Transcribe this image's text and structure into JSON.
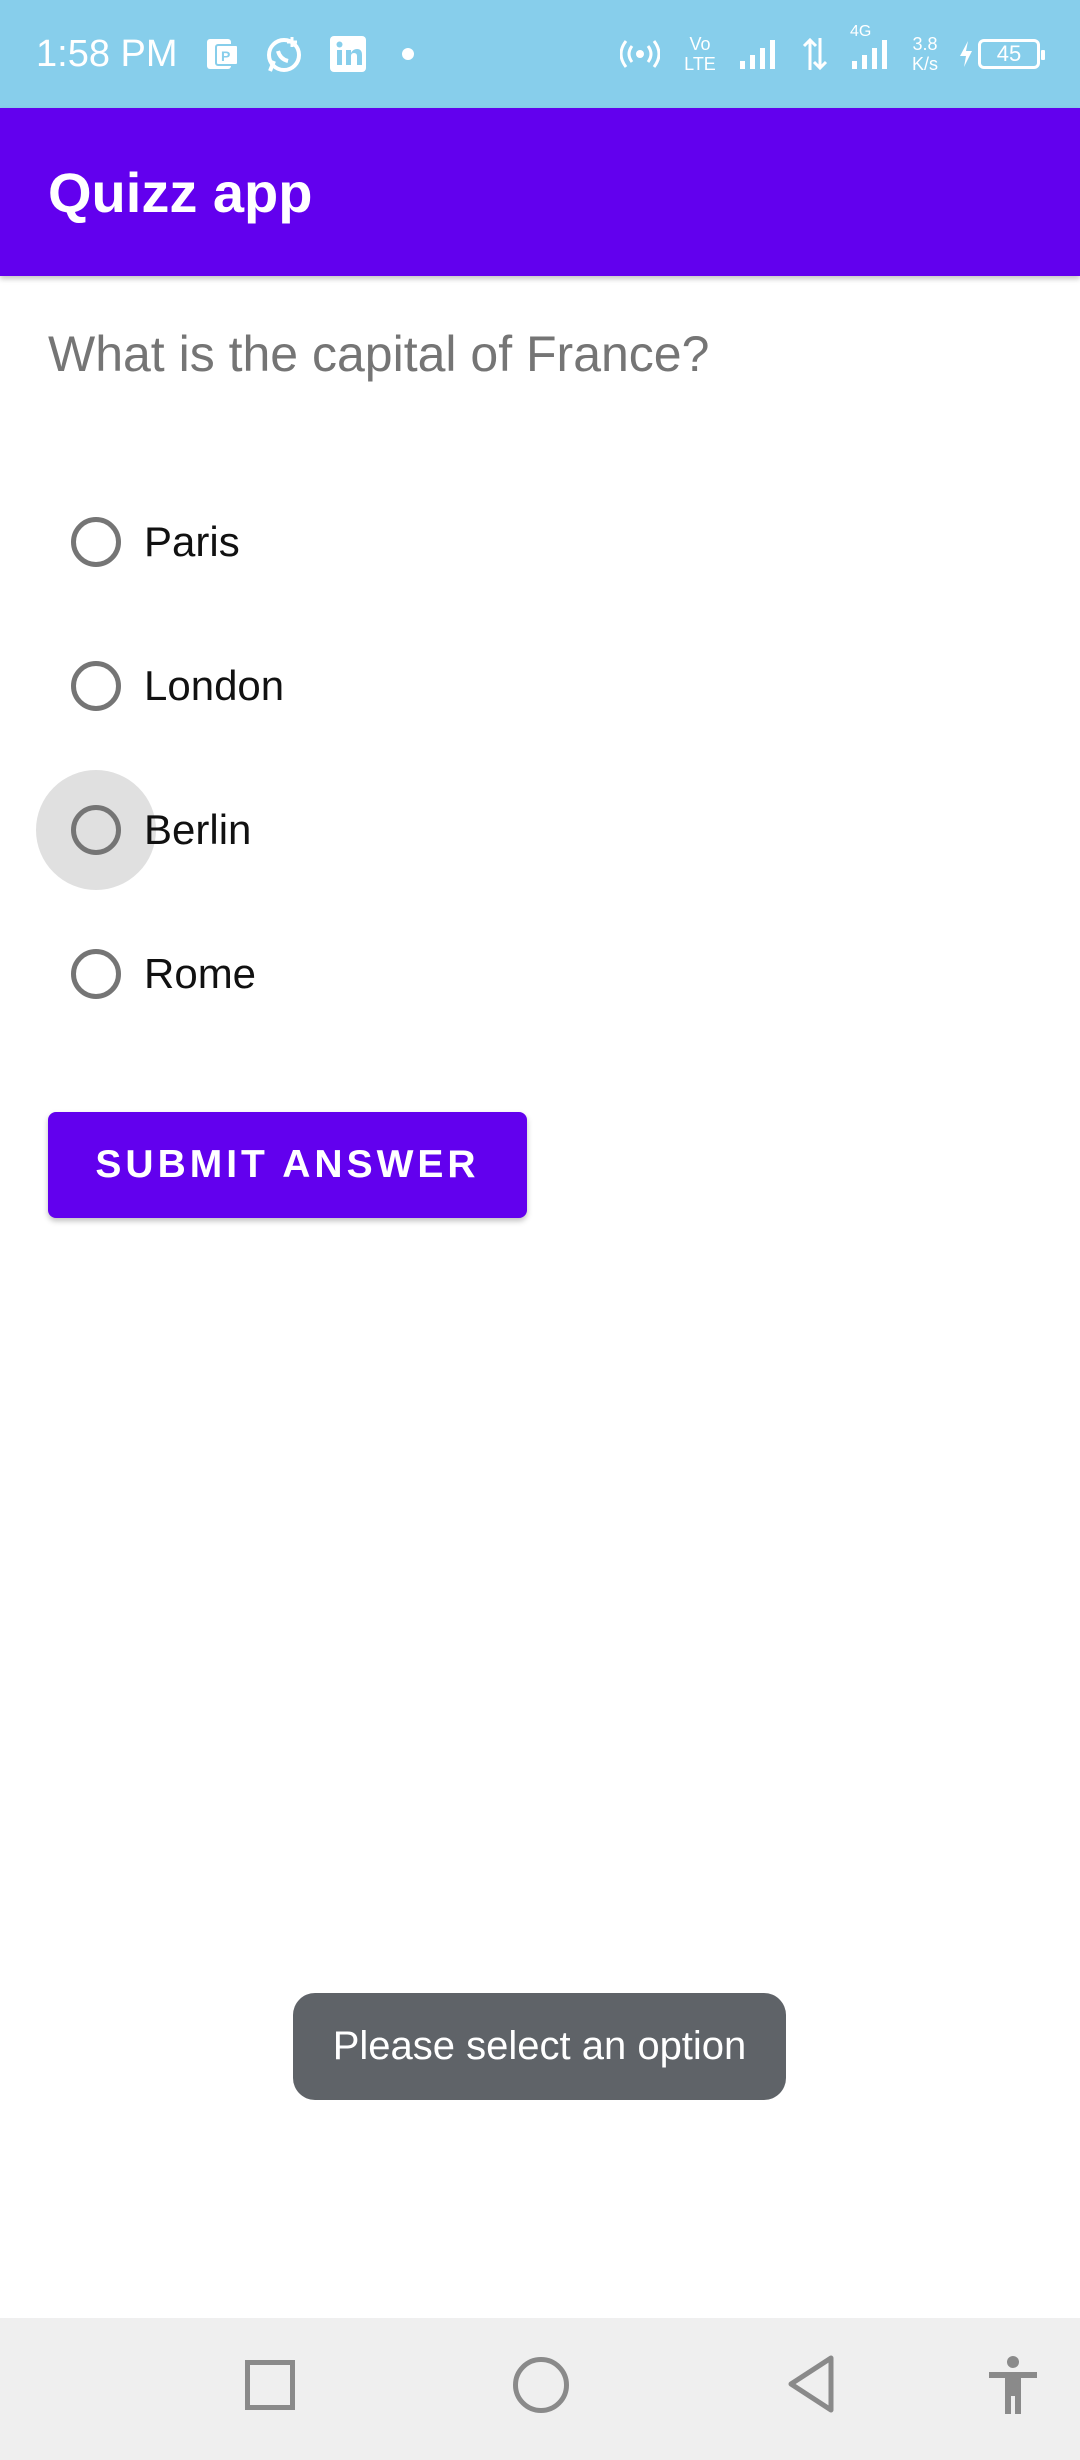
{
  "status_bar": {
    "time": "1:58 PM",
    "network_type": "4G",
    "volte": "Vo LTE",
    "speed_value": "3.8",
    "speed_unit": "K/s",
    "battery": "45"
  },
  "app_bar": {
    "title": "Quizz app"
  },
  "quiz": {
    "question": "What is the capital of France?",
    "options": [
      {
        "label": "Paris",
        "selected": false
      },
      {
        "label": "London",
        "selected": false
      },
      {
        "label": "Berlin",
        "selected": false
      },
      {
        "label": "Rome",
        "selected": false
      }
    ],
    "submit_label": "SUBMIT ANSWER"
  },
  "toast": {
    "message": "Please select an option"
  },
  "colors": {
    "primary": "#6200ee",
    "status_bar": "#87ceeb",
    "toast_bg": "#5f6368"
  },
  "icons": {
    "status": [
      "pdf-icon",
      "whatsapp-icon",
      "linkedin-icon",
      "hotspot-icon",
      "signal-icon",
      "data-arrows-icon",
      "battery-icon"
    ],
    "nav": [
      "recents-icon",
      "home-icon",
      "back-icon",
      "accessibility-icon"
    ]
  }
}
